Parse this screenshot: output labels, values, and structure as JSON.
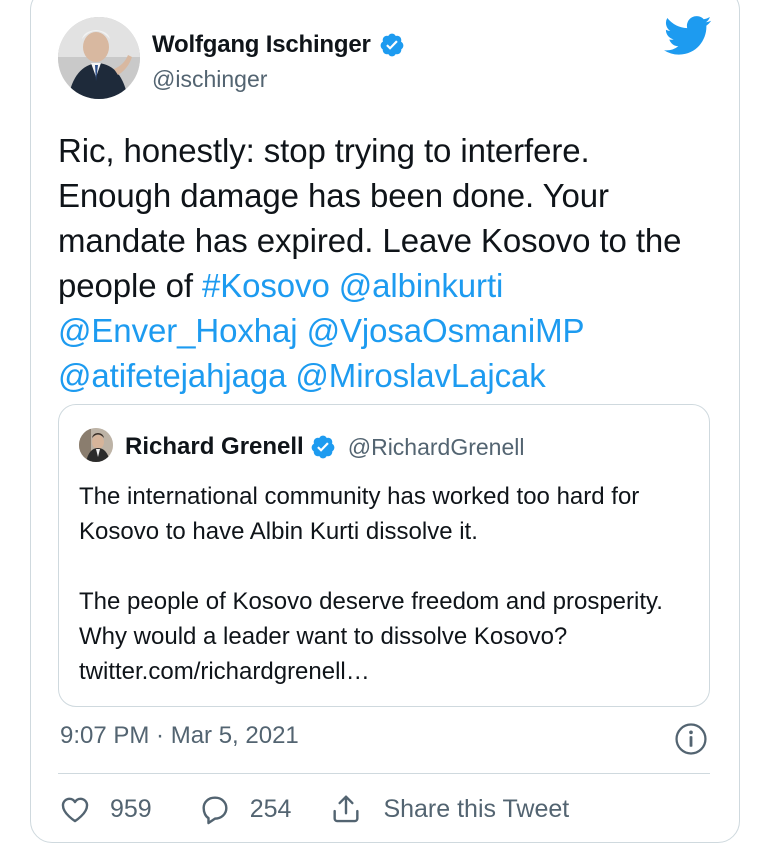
{
  "tweet": {
    "author": {
      "name": "Wolfgang Ischinger",
      "handle": "@ischinger"
    },
    "text_plain": "Ric, honestly: stop trying to interfere. Enough damage has been done. Your mandate has expired. Leave Kosovo to the people of ",
    "hashtag": "#Kosovo",
    "mentions": [
      "@albinkurti",
      "@Enver_Hoxhaj",
      "@VjosaOsmaniMP",
      "@atifetejahjaga",
      "@MiroslavLajcak"
    ],
    "timestamp": "9:07 PM · Mar 5, 2021",
    "likes": "959",
    "replies": "254",
    "share_label": "Share this Tweet"
  },
  "quoted": {
    "author": {
      "name": "Richard Grenell",
      "handle": "@RichardGrenell"
    },
    "paragraph1": "The international community has worked too hard for Kosovo to have Albin Kurti dissolve it.",
    "paragraph2": "The people of Kosovo deserve freedom and prosperity. Why would a leader want to dissolve Kosovo? twitter.com/richardgrenell…"
  },
  "colors": {
    "accent": "#1d9bf0",
    "text": "#0f1419",
    "muted": "#536471",
    "border": "#cfd9de"
  },
  "icons": [
    "twitter-bird-icon",
    "verified-badge-icon",
    "info-icon",
    "heart-icon",
    "reply-icon",
    "share-icon"
  ]
}
